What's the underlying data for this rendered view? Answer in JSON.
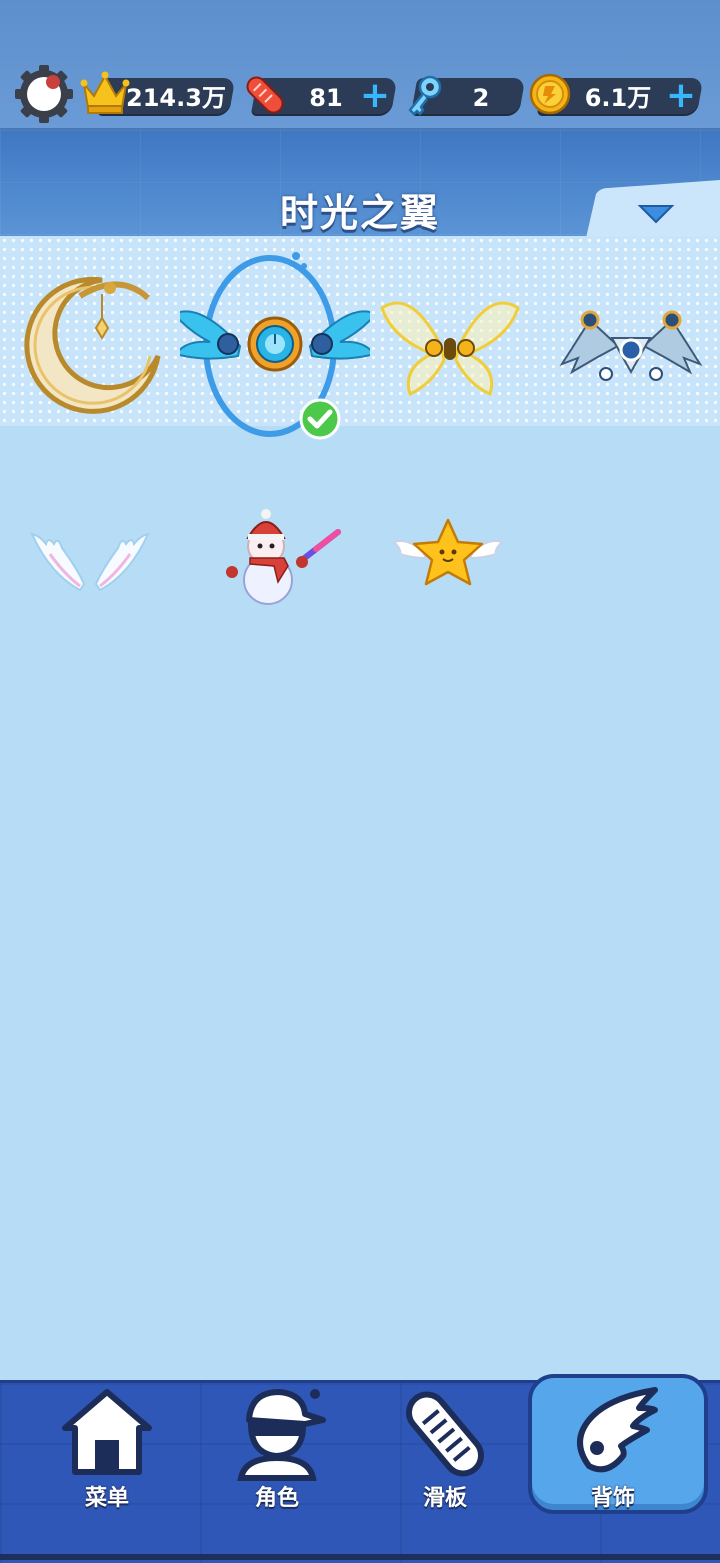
{
  "top_bar": {
    "crown": {
      "value": "214.3万",
      "icon": "crown-icon"
    },
    "skateboard_tokens": {
      "value": "81",
      "icon": "skateboard-token-icon",
      "plus_label": "+"
    },
    "keys": {
      "value": "2",
      "icon": "key-icon"
    },
    "coins": {
      "value": "6.1万",
      "icon": "coin-icon",
      "plus_label": "+"
    },
    "settings_icon": "gear-icon"
  },
  "header": {
    "title": "时光之翼",
    "dropdown_icon": "triangle-down-icon"
  },
  "items": [
    {
      "name": "moon-wings",
      "selected": false
    },
    {
      "name": "time-wings",
      "selected": true
    },
    {
      "name": "golden-butterfly-wings",
      "selected": false
    },
    {
      "name": "mech-wings",
      "selected": false
    },
    {
      "name": "angel-wings",
      "selected": false
    },
    {
      "name": "snowman-backpack",
      "selected": false
    },
    {
      "name": "star-wings",
      "selected": false
    }
  ],
  "bottom_nav": {
    "tabs": [
      {
        "label": "菜单",
        "icon": "home-icon",
        "active": false
      },
      {
        "label": "角色",
        "icon": "character-icon",
        "active": false
      },
      {
        "label": "滑板",
        "icon": "skateboard-icon",
        "active": false
      },
      {
        "label": "背饰",
        "icon": "wing-icon",
        "active": true
      }
    ]
  },
  "colors": {
    "accent": "#36b7ff",
    "background": "#b7dcf6",
    "nav_background": "#2f57b8",
    "active_tab": "#56a6ec",
    "selected_check": "#4cc94a"
  }
}
